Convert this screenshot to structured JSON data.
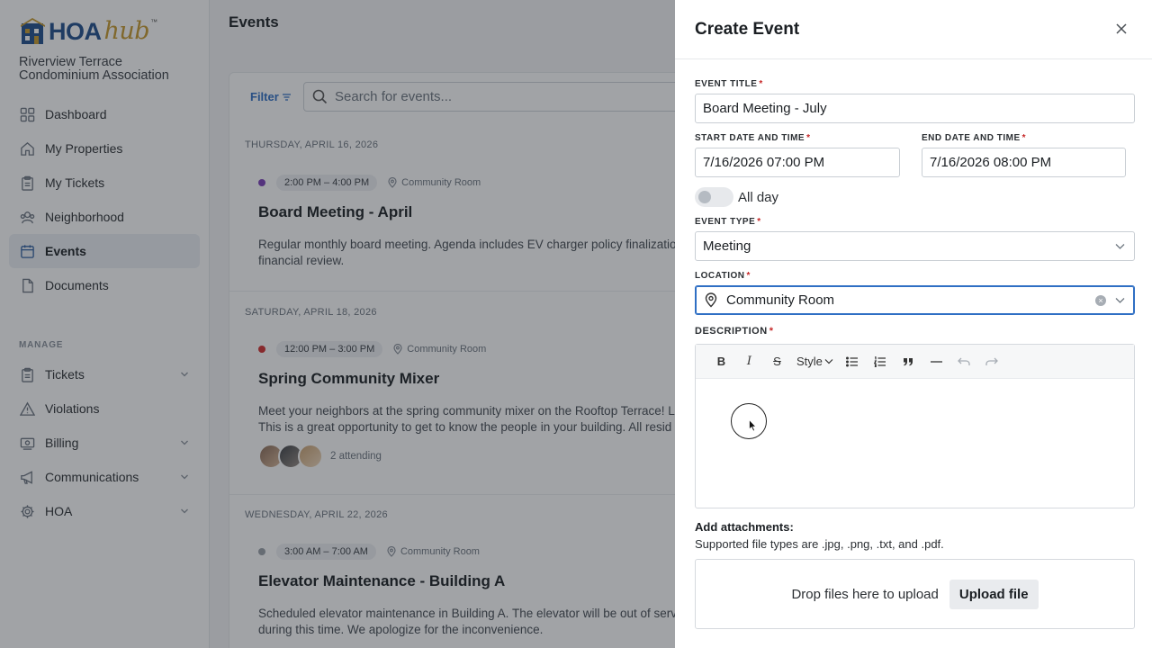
{
  "logo": {
    "hoa": "HOA",
    "hub": "hub",
    "tm": "™"
  },
  "org_name": "Riverview Terrace Condominium Association",
  "nav": {
    "items": [
      {
        "label": "Dashboard",
        "icon": "dashboard-icon"
      },
      {
        "label": "My Properties",
        "icon": "home-icon"
      },
      {
        "label": "My Tickets",
        "icon": "clipboard-icon"
      },
      {
        "label": "Neighborhood",
        "icon": "people-icon"
      },
      {
        "label": "Events",
        "icon": "calendar-icon",
        "active": true
      },
      {
        "label": "Documents",
        "icon": "document-icon"
      }
    ],
    "manage_label": "MANAGE",
    "manage_items": [
      {
        "label": "Tickets",
        "icon": "clipboard-icon",
        "expandable": true
      },
      {
        "label": "Violations",
        "icon": "warning-icon",
        "expandable": false
      },
      {
        "label": "Billing",
        "icon": "billing-icon",
        "expandable": true
      },
      {
        "label": "Communications",
        "icon": "megaphone-icon",
        "expandable": true
      },
      {
        "label": "HOA",
        "icon": "gear-icon",
        "expandable": true
      }
    ]
  },
  "main": {
    "title": "Events",
    "filter_label": "Filter",
    "search_placeholder": "Search for events...",
    "days": [
      {
        "label": "THURSDAY, APRIL 16, 2026",
        "events": [
          {
            "time": "2:00 PM – 4:00 PM",
            "location": "Community Room",
            "title": "Board Meeting - April",
            "dot_color": "#7b3fb8",
            "desc_line1": "Regular monthly board meeting. Agenda includes EV charger policy finalizatio",
            "desc_line2": "financial review."
          }
        ]
      },
      {
        "label": "SATURDAY, APRIL 18, 2026",
        "events": [
          {
            "time": "12:00 PM – 3:00 PM",
            "location": "Community Room",
            "title": "Spring Community Mixer",
            "dot_color": "#d32f2f",
            "desc_line1": "Meet your neighbors at the spring community mixer on the Rooftop Terrace! L",
            "desc_line2": "This is a great opportunity to get to know the people in your building. All resid",
            "attending": "2 attending"
          }
        ]
      },
      {
        "label": "WEDNESDAY, APRIL 22, 2026",
        "events": [
          {
            "time": "3:00 AM – 7:00 AM",
            "location": "Community Room",
            "title": "Elevator Maintenance - Building A",
            "dot_color": "#9aa1a8",
            "desc_line1": "Scheduled elevator maintenance in Building A. The elevator will be out of serv",
            "desc_line2": "during this time. We apologize for the inconvenience."
          }
        ]
      }
    ]
  },
  "drawer": {
    "title": "Create Event",
    "event_title_label": "EVENT TITLE",
    "event_title_value": "Board Meeting - July",
    "start_label": "START DATE AND TIME",
    "start_value": "7/16/2026 07:00 PM",
    "end_label": "END DATE AND TIME",
    "end_value": "7/16/2026 08:00 PM",
    "all_day_label": "All day",
    "all_day_on": false,
    "event_type_label": "EVENT TYPE",
    "event_type_value": "Meeting",
    "location_label": "LOCATION",
    "location_value": "Community Room",
    "description_label": "DESCRIPTION",
    "required_mark": "*",
    "toolbar": {
      "bold": "B",
      "italic": "I",
      "strike": "S",
      "style": "Style"
    },
    "attach_title": "Add attachments:",
    "attach_sub": "Supported file types are .jpg, .png, .txt, and .pdf.",
    "dropzone_text": "Drop files here to upload",
    "upload_button": "Upload file"
  },
  "colors": {
    "accent": "#2f6fc4",
    "required": "#c62828",
    "brand_blue": "#1f4e8c",
    "brand_gold": "#c79a2e"
  }
}
